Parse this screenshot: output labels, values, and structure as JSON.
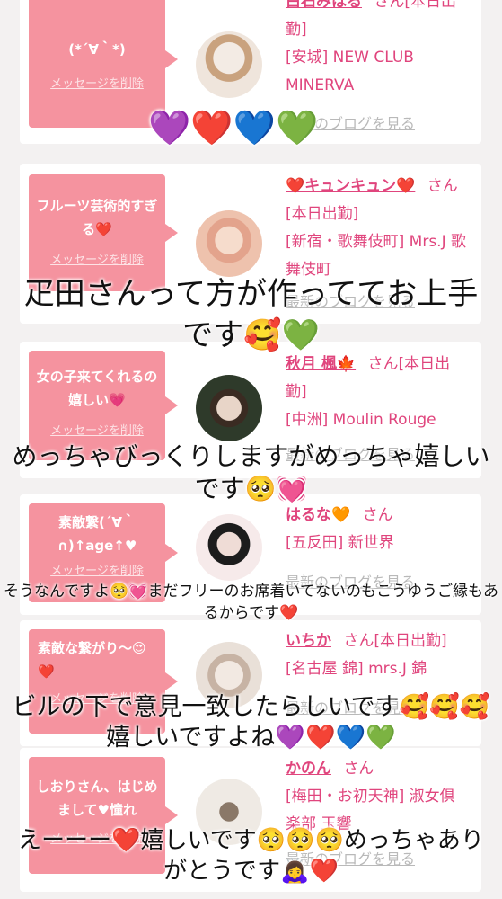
{
  "cards": [
    {
      "message": "(*´∀｀*)",
      "delete_label": "メッセージを削除",
      "name": "白石みはる",
      "suffix": "さん[本日出勤]",
      "area": "[安城] NEW CLUB MINERVA",
      "blog": "最新のブログを見る",
      "avatar_colors": [
        "#f0e6da",
        "#c9a27e"
      ]
    },
    {
      "message": "フルーツ芸術的すぎる❤️",
      "delete_label": "メッセージを削除",
      "name": "❤️キュンキュン❤️",
      "suffix": "さん[本日出勤]",
      "area": "[新宿・歌舞伎町] Mrs.J 歌舞伎町",
      "blog": "最新のブログを見る",
      "avatar_colors": [
        "#f3d5c5",
        "#e3a38c"
      ]
    },
    {
      "message": "女の子来てくれるの嬉しい💗",
      "delete_label": "メッセージを削除",
      "name": "秋月 楓🍁",
      "suffix": "さん[本日出勤]",
      "area": "[中洲] Moulin Rouge",
      "blog": "最新のブログを見る",
      "avatar_colors": [
        "#2e3a2a",
        "#d9c2b0"
      ]
    },
    {
      "message": "素敵繋(´∀｀∩)↑age↑♥",
      "delete_label": "メッセージを削除",
      "name": "はるな🧡",
      "suffix": "さん",
      "area": "[五反田] 新世界",
      "blog": "最新のブログを見る",
      "avatar_colors": [
        "#1c1c1c",
        "#e7d5d0"
      ]
    },
    {
      "message": "素敵な繋がり〜😍❤️",
      "delete_label": "メッセージを削除",
      "name": "いちか",
      "suffix": "さん[本日出勤]",
      "area": "[名古屋 錦] mrs.J 錦",
      "blog": "最新のブログを見る",
      "avatar_colors": [
        "#eadfd6",
        "#c7b3a4"
      ]
    },
    {
      "message": "しおりさん、はじめまして♥憧れ",
      "delete_label": "メッセージを削除",
      "name": "かのん",
      "suffix": "さん",
      "area": "[梅田・お初天神] 淑女倶楽部 玉響",
      "blog": "最新のブログを見る",
      "avatar_colors": [
        "#efeae4",
        "#8a7868"
      ]
    }
  ],
  "overlays": {
    "hearts_row": "💜❤️💙💚",
    "caption1": "疋田さんって方が作っててお上手です🥰💚",
    "caption2": "めっちゃびっくりしますがめっちゃ嬉しいです🥺💓",
    "caption3": "そうなんですよ🥺💓まだフリーのお席着いてないのもこうゆうご縁もあるからです❤️",
    "caption4": "ビルの下で意見一致したらしいです🥰🥰🥰嬉しいですよね💜❤️💙💚",
    "caption5": "えーーー❤️嬉しいです🥺🥺🥺めっちゃありがとうです🙇‍♀️❤️"
  },
  "colors": {
    "accent_pink": "#f5939f",
    "name_pink": "#e0457d",
    "link_gray": "#b9b9b9"
  }
}
